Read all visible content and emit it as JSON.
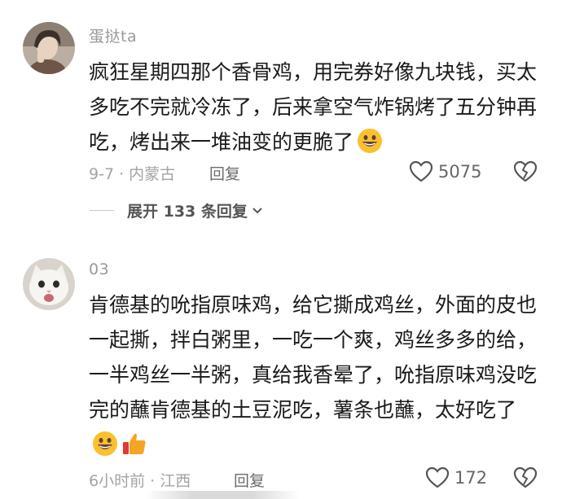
{
  "comments": [
    {
      "username": "蛋挞ta",
      "avatar": "woman-portrait-avatar",
      "text": "疯狂星期四那个香骨鸡，用完券好像九块钱，买太多吃不完就冷冻了，后来拿空气炸锅烤了五分钟再吃，烤出来一堆油变的更脆了",
      "emoji": "grinning-face-emoji",
      "meta": "9-7 · 内蒙古",
      "reply_label": "回复",
      "likes": "5075",
      "expand_label": "展开 133 条回复"
    },
    {
      "username": "03",
      "avatar": "white-cat-avatar",
      "text": "肯德基的吮指原味鸡，给它撕成鸡丝，外面的皮也一起撕，拌白粥里，一吃一个爽，鸡丝多多的给，一半鸡丝一半粥，真给我香晕了，吮指原味鸡没吃完的蘸肯德基的土豆泥吃，薯条也蘸，太好吃了",
      "emojis": [
        "grinning-face-emoji",
        "thumbs-up-emoji"
      ],
      "meta": "6小时前 · 江西",
      "reply_label": "回复",
      "likes": "172"
    }
  ],
  "colors": {
    "text_primary": "#1a1a1a",
    "text_secondary": "#9a9a9a",
    "emoji_yellow": "#fbc02d",
    "thumb_orange": "#f5a524"
  }
}
